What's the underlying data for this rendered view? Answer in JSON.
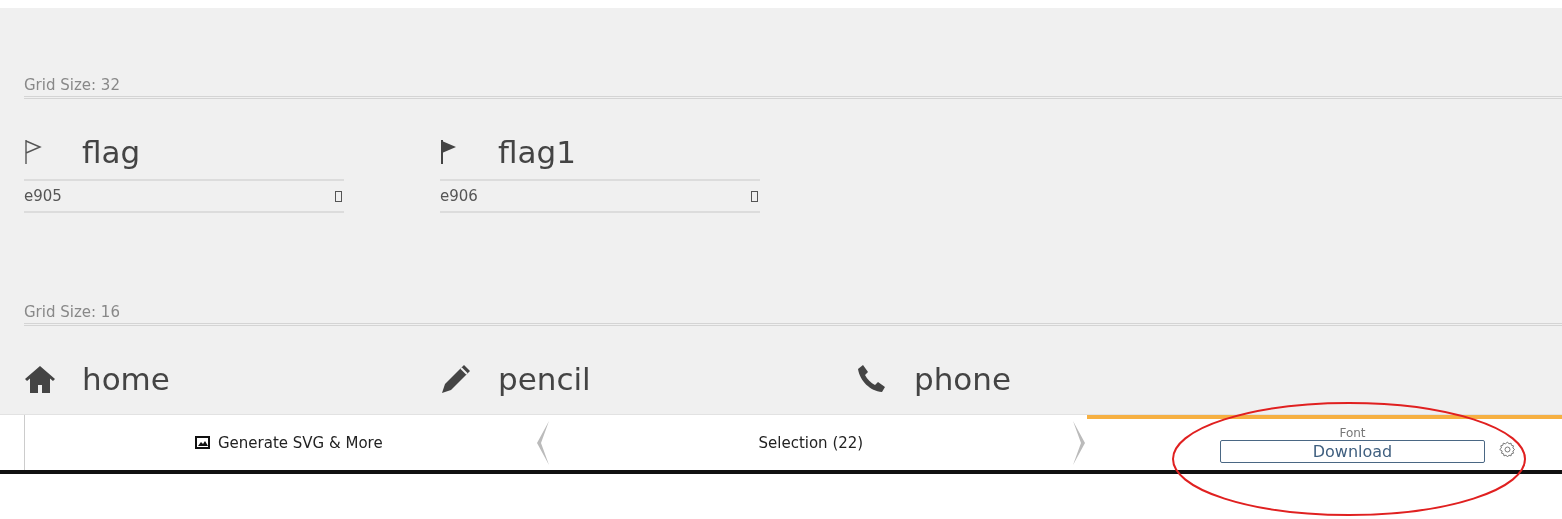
{
  "sections": [
    {
      "title": "Grid Size: 32",
      "glyphs": [
        {
          "kind": "flag-outline",
          "name": "flag",
          "code": "e905"
        },
        {
          "kind": "flag-solid",
          "name": "flag1",
          "code": "e906"
        }
      ]
    },
    {
      "title": "Grid Size: 16",
      "glyphs": [
        {
          "kind": "home",
          "name": "home"
        },
        {
          "kind": "pencil",
          "name": "pencil"
        },
        {
          "kind": "phone",
          "name": "phone"
        }
      ]
    }
  ],
  "bottom_bar": {
    "generate_label": "Generate SVG & More",
    "selection_label": "Selection (22)",
    "font_label": "Font",
    "download_label": "Download"
  },
  "annotation": {
    "kind": "ellipse"
  }
}
